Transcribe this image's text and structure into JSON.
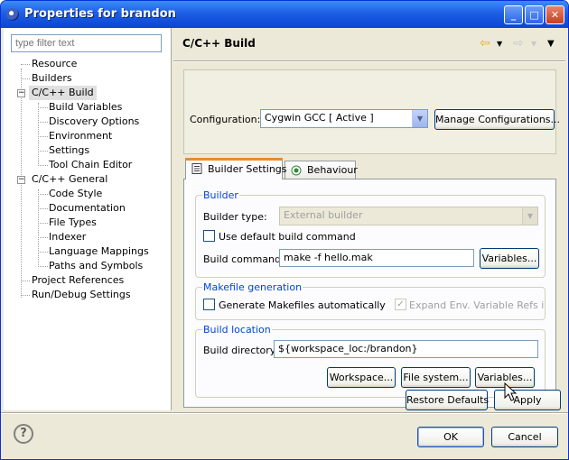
{
  "window": {
    "title": "Properties for brandon"
  },
  "filter": {
    "placeholder": "type filter text"
  },
  "tree": {
    "items": [
      {
        "label": "Resource"
      },
      {
        "label": "Builders"
      },
      {
        "label": "C/C++ Build"
      },
      {
        "label": "Build Variables"
      },
      {
        "label": "Discovery Options"
      },
      {
        "label": "Environment"
      },
      {
        "label": "Settings"
      },
      {
        "label": "Tool Chain Editor"
      },
      {
        "label": "C/C++ General"
      },
      {
        "label": "Code Style"
      },
      {
        "label": "Documentation"
      },
      {
        "label": "File Types"
      },
      {
        "label": "Indexer"
      },
      {
        "label": "Language Mappings"
      },
      {
        "label": "Paths and Symbols"
      },
      {
        "label": "Project References"
      },
      {
        "label": "Run/Debug Settings"
      }
    ],
    "selected": "C/C++ Build"
  },
  "page": {
    "title": "C/C++ Build"
  },
  "configuration": {
    "label": "Configuration:",
    "value": "Cygwin GCC  [ Active ]",
    "manage_label": "Manage Configurations..."
  },
  "tabs": [
    {
      "label": "Builder Settings",
      "active": true
    },
    {
      "label": "Behaviour",
      "active": false
    }
  ],
  "builder": {
    "group_title": "Builder",
    "type_label": "Builder type:",
    "type_value": "External builder",
    "use_default_label": "Use default build command",
    "command_label": "Build command:",
    "command_value": "make -f hello.mak",
    "variables_label": "Variables..."
  },
  "makefile": {
    "group_title": "Makefile generation",
    "generate_label": "Generate Makefiles automatically",
    "expand_label": "Expand Env. Variable Refs in Ma"
  },
  "location": {
    "group_title": "Build location",
    "dir_label": "Build directory:",
    "dir_value": "${workspace_loc:/brandon}",
    "workspace_label": "Workspace...",
    "filesystem_label": "File system...",
    "variables_label": "Variables..."
  },
  "actions": {
    "restore_label": "Restore Defaults",
    "apply_label": "Apply",
    "ok_label": "OK",
    "cancel_label": "Cancel",
    "help_symbol": "?"
  },
  "colors": {
    "titlebar": "#0a45d2",
    "tab_accent": "#e68b2c",
    "group_title": "#0046d5",
    "nav_back": "#e8b020"
  }
}
